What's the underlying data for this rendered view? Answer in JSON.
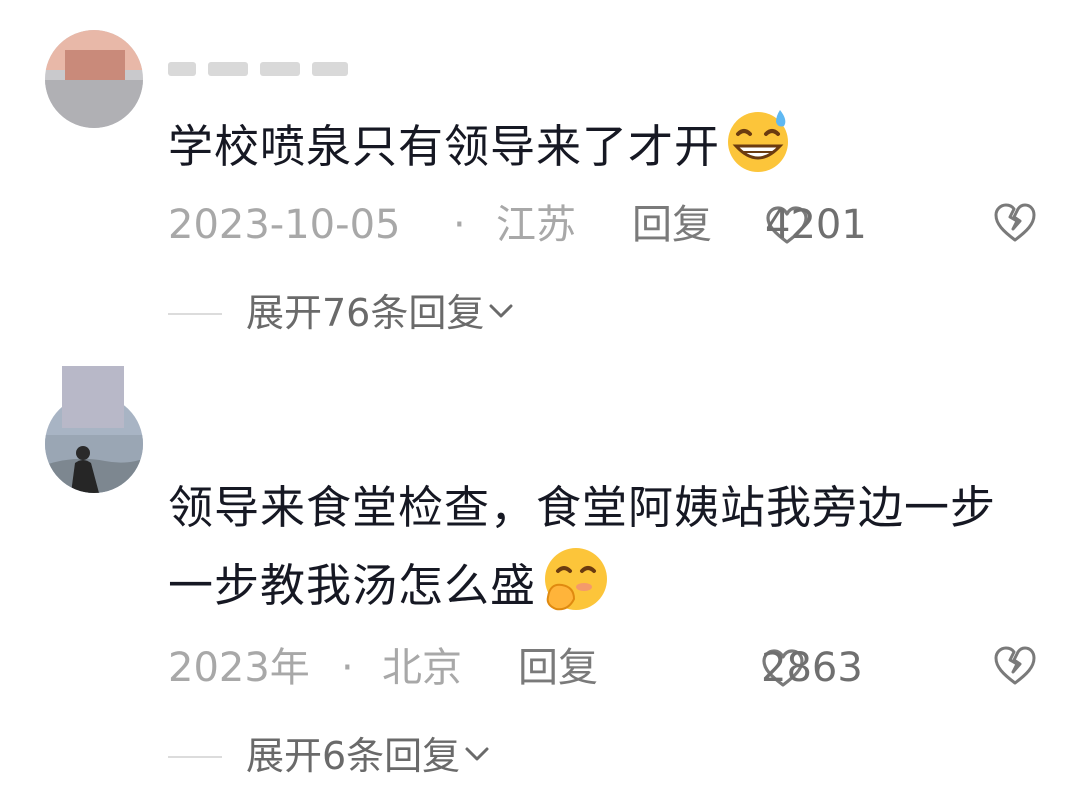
{
  "comments": [
    {
      "text": "学校喷泉只有领导来了才开",
      "emoji": "grinning-sweat-emoji",
      "date": "2023-10-05",
      "separator": "·",
      "location": "江苏",
      "reply_label": "回复",
      "likes": "4201",
      "expand_label": "展开76条回复"
    },
    {
      "text": "领导来食堂检查，食堂阿姨站我旁边一步一步教我汤怎么盛",
      "emoji": "hand-over-mouth-emoji",
      "date": "2023年",
      "separator": "·",
      "location": "北京",
      "reply_label": "回复",
      "likes": "2863",
      "expand_label": "展开6条回复"
    }
  ],
  "colors": {
    "text": "#161823",
    "meta": "#a8a8a8",
    "action": "#7a7a7a"
  }
}
